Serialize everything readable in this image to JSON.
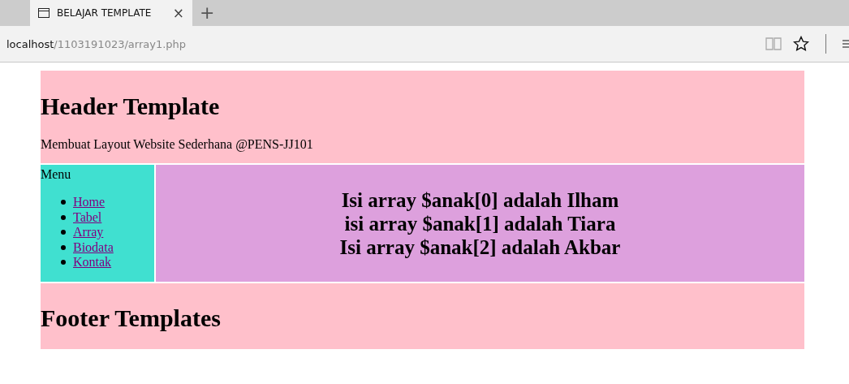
{
  "browser": {
    "tab": {
      "title": "BELAJAR TEMPLATE",
      "close": "×",
      "new_tab": "+"
    },
    "address": {
      "host": "localhost",
      "path": "/1103191023/array1.php"
    }
  },
  "header": {
    "title": "Header Template",
    "subtitle": "Membuat Layout Website Sederhana @PENS-JJ101"
  },
  "menu": {
    "title": "Menu",
    "items": [
      {
        "label": "Home"
      },
      {
        "label": "Tabel"
      },
      {
        "label": "Array"
      },
      {
        "label": "Biodata"
      },
      {
        "label": "Kontak"
      }
    ]
  },
  "content": {
    "lines": [
      "Isi array $anak[0] adalah Ilham",
      "isi array $anak[1] adalah Tiara",
      "Isi array $anak[2] adalah Akbar"
    ]
  },
  "footer": {
    "title": "Footer Templates"
  }
}
